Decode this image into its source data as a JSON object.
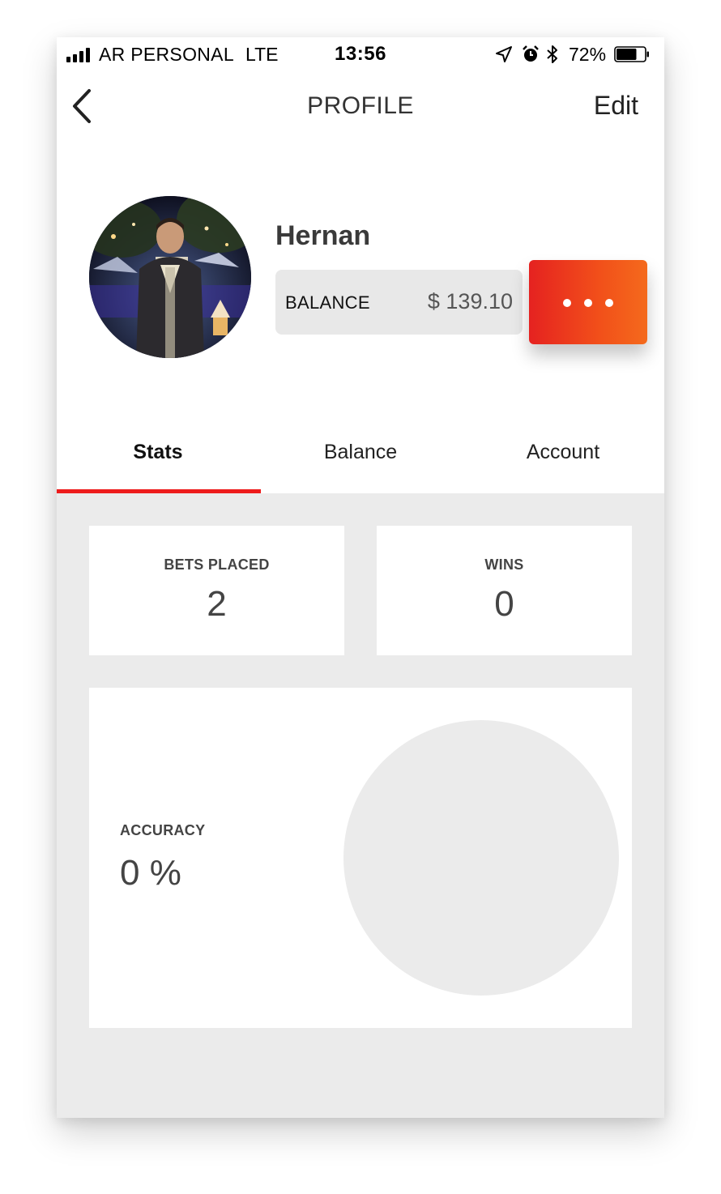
{
  "status_bar": {
    "carrier": "AR PERSONAL",
    "network": "LTE",
    "time": "13:56",
    "battery": "72%",
    "battery_level": 0.72,
    "icons": [
      "signal-icon",
      "location-arrow-icon",
      "alarm-icon",
      "bluetooth-icon",
      "battery-icon"
    ]
  },
  "nav": {
    "back_icon": "chevron-left-icon",
    "title": "PROFILE",
    "edit_label": "Edit"
  },
  "profile": {
    "name": "Hernan",
    "balance_label": "BALANCE",
    "balance_value": "$ 139.10",
    "more_icon": "ellipsis-icon"
  },
  "tabs": [
    {
      "label": "Stats",
      "active": true
    },
    {
      "label": "Balance",
      "active": false
    },
    {
      "label": "Account",
      "active": false
    }
  ],
  "stats": {
    "bets_placed_label": "BETS PLACED",
    "bets_placed_value": "2",
    "wins_label": "WINS",
    "wins_value": "0",
    "accuracy_label": "ACCURACY",
    "accuracy_value": "0 %"
  },
  "colors": {
    "accent": "#ee1b1b",
    "button_gradient_start": "#e52220",
    "button_gradient_end": "#f46a1c",
    "background": "#ebebeb",
    "chart_empty": "#ebebeb"
  }
}
